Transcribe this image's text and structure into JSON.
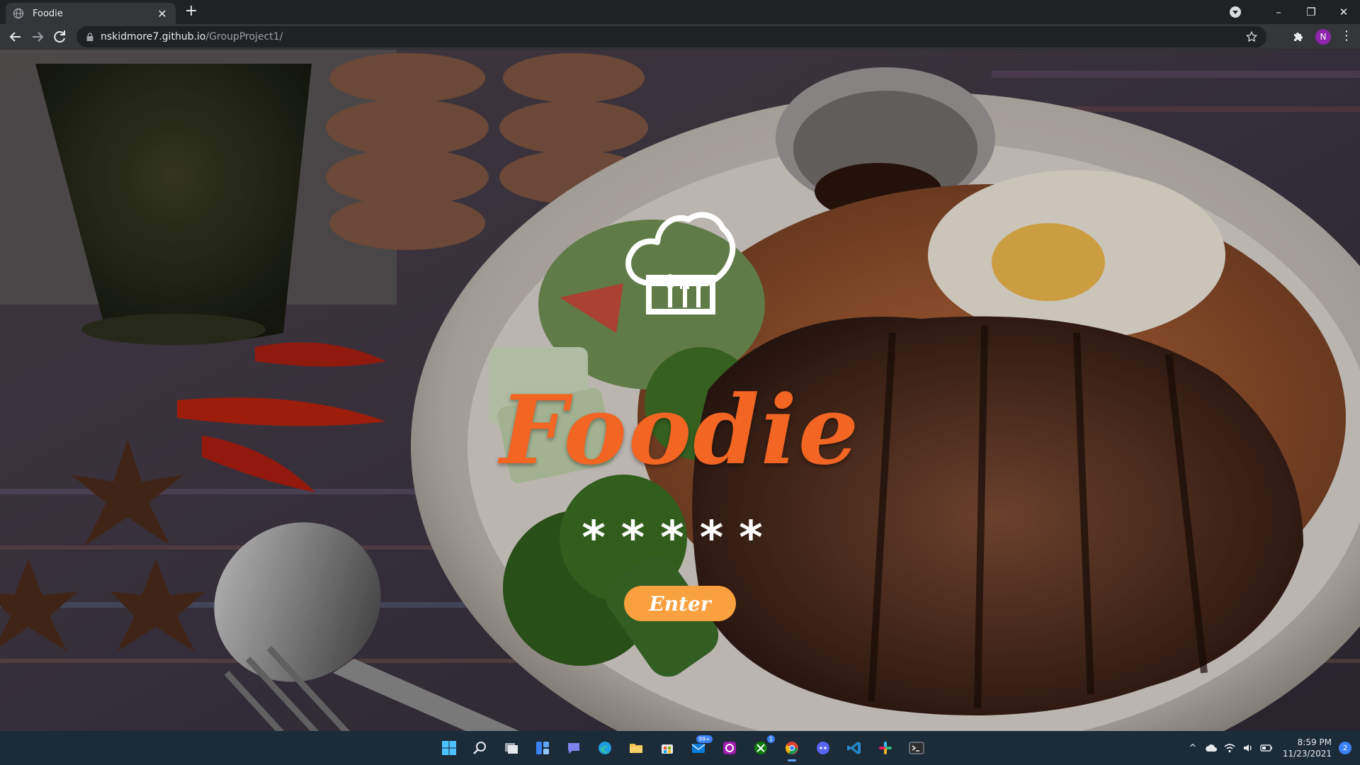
{
  "browser": {
    "tab": {
      "title": "Foodie",
      "close": "✕"
    },
    "new_tab": "+",
    "url": {
      "host": "nskidmore7.github.io",
      "path": "/GroupProject1/"
    },
    "profile_initial": "N",
    "menu": "⋮",
    "window_controls": {
      "minimize": "–",
      "restore": "❐",
      "close": "✕"
    }
  },
  "page": {
    "logo_icon": "chef-hat-icon",
    "brand": "Foodie",
    "rating_stars": "*****",
    "enter_label": "Enter",
    "colors": {
      "brand": "#f26522",
      "button": "#f9a03f"
    }
  },
  "taskbar": {
    "apps": [
      {
        "name": "windows-start-icon"
      },
      {
        "name": "search-icon"
      },
      {
        "name": "task-view-icon"
      },
      {
        "name": "widgets-icon"
      },
      {
        "name": "teams-chat-icon"
      },
      {
        "name": "edge-icon"
      },
      {
        "name": "file-explorer-icon"
      },
      {
        "name": "microsoft-store-icon"
      },
      {
        "name": "mail-icon",
        "badge": "99+"
      },
      {
        "name": "app-icon"
      },
      {
        "name": "xbox-icon",
        "badge": "1"
      },
      {
        "name": "chrome-icon"
      },
      {
        "name": "discord-icon"
      },
      {
        "name": "vscode-icon"
      },
      {
        "name": "slack-icon"
      },
      {
        "name": "terminal-icon"
      }
    ],
    "tray": {
      "overflow": "^",
      "time": "8:59 PM",
      "date": "11/23/2021",
      "notifications": "2"
    }
  }
}
